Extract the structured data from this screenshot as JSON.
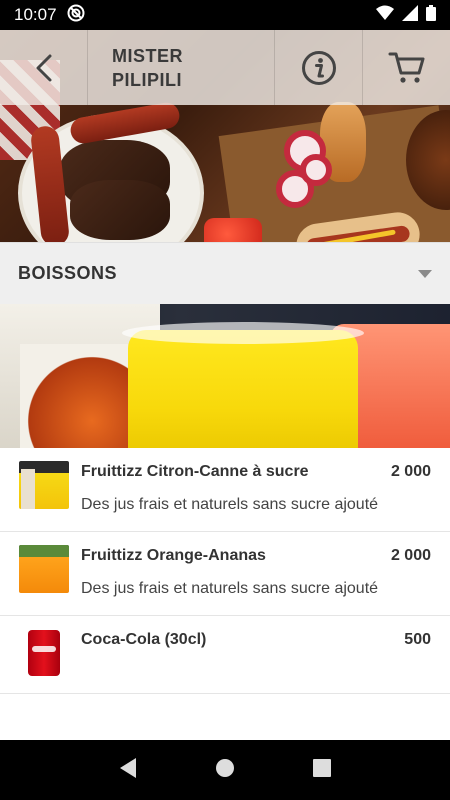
{
  "status_bar": {
    "time": "10:07"
  },
  "header": {
    "title_line1": "MISTER",
    "title_line2": "PILIPILI"
  },
  "category": {
    "label": "BOISSONS"
  },
  "items": [
    {
      "name": "Fruittizz Citron-Canne à sucre",
      "price": "2 000",
      "description": "Des jus frais et naturels sans sucre ajouté",
      "thumb": "yellow-juice-thumbnail"
    },
    {
      "name": "Fruittizz Orange-Ananas",
      "price": "2 000",
      "description": "Des jus frais et naturels sans sucre ajouté",
      "thumb": "orange-juice-thumbnail"
    },
    {
      "name": "Coca-Cola (30cl)",
      "price": "500",
      "description": "",
      "thumb": "coca-cola-can-thumbnail"
    }
  ],
  "icons": {
    "back": "back-arrow-icon",
    "info": "info-icon",
    "cart": "cart-icon",
    "dropdown": "dropdown-arrow-icon",
    "wifi": "wifi-icon",
    "signal": "signal-icon",
    "battery": "battery-icon"
  }
}
